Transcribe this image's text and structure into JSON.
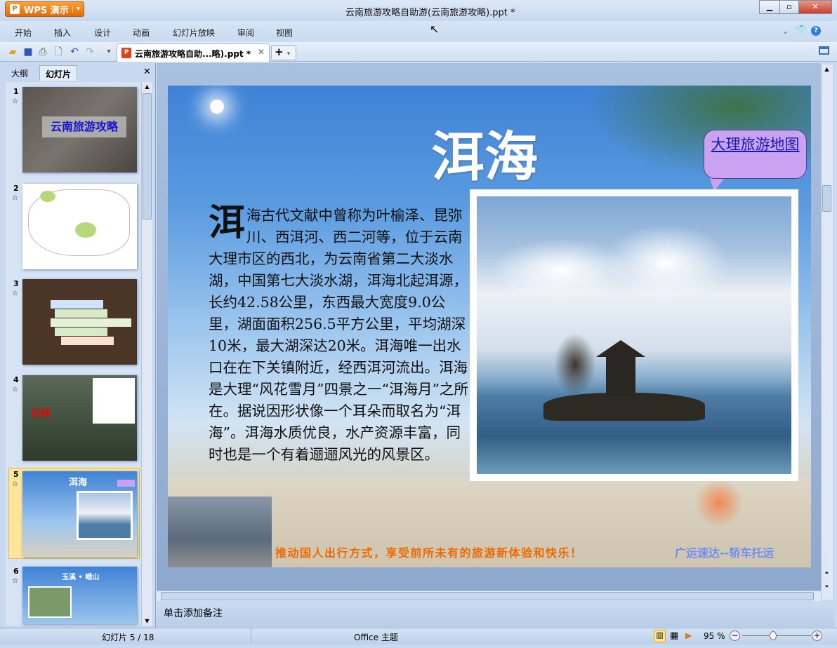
{
  "app": {
    "name": "WPS 演示",
    "window_title": "云南旅游攻略自助游(云南旅游攻略).ppt *"
  },
  "menu": [
    "开始",
    "插入",
    "设计",
    "动画",
    "幻灯片放映",
    "审阅",
    "视图"
  ],
  "doc_tab": {
    "label": "云南旅游攻略自助...略).ppt *"
  },
  "panel": {
    "tabs": [
      "大纲",
      "幻灯片"
    ],
    "active_tab": "幻灯片"
  },
  "thumbnails": [
    {
      "num": "1",
      "title": "云南旅游攻略"
    },
    {
      "num": "2",
      "title": ""
    },
    {
      "num": "3",
      "title": ""
    },
    {
      "num": "4",
      "title": "石林"
    },
    {
      "num": "5",
      "title": "洱海",
      "selected": true
    },
    {
      "num": "6",
      "title": "玉溪 • 峨山"
    }
  ],
  "slide": {
    "title": "洱海",
    "callout_link": "大理旅游地图",
    "drop_cap": "洱",
    "body": "海古代文献中曾称为叶榆泽、昆弥川、西洱河、西二河等，位于云南大理市区的西北，为云南省第二大淡水湖，中国第七大淡水湖，洱海北起洱源，长约42.58公里，东西最大宽度9.0公里，湖面面积256.5平方公里，平均湖深10米，最大湖深达20米。洱海唯一出水口在在下关镇附近，经西洱河流出。洱海是大理“风花雪月”四景之一“洱海月”之所在。据说因形状像一个耳朵而取名为“洱海”。洱海水质优良，水产资源丰富，同时也是一个有着逦逦风光的风景区。",
    "slogan": "推动国人出行方式，享受前所未有的旅游新体验和快乐！",
    "brand": "广运速达--轿车托运"
  },
  "notes_placeholder": "单击添加备注",
  "status": {
    "slide_counter": "幻灯片 5 / 18",
    "theme": "Office 主题",
    "zoom": "95 %",
    "zoom_percent": 95
  }
}
